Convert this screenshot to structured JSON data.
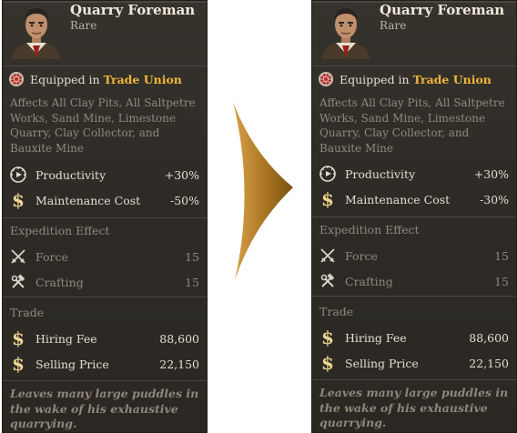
{
  "cards": {
    "before": {
      "name": "Quarry Foreman",
      "rarity": "Rare",
      "equipped_prefix": "Equipped in",
      "equipped_building": "Trade Union",
      "affects": "Affects All Clay Pits, All Saltpetre Works, Sand Mine, Limestone Quarry, Clay Collector, and Bauxite Mine",
      "productivity": {
        "label": "Productivity",
        "value": "+30%"
      },
      "maintenance": {
        "label": "Maintenance Cost",
        "value": "-50%"
      },
      "expedition_title": "Expedition Effect",
      "force": {
        "label": "Force",
        "value": "15"
      },
      "crafting": {
        "label": "Crafting",
        "value": "15"
      },
      "trade_title": "Trade",
      "hiring_fee": {
        "label": "Hiring Fee",
        "value": "88,600"
      },
      "selling_price": {
        "label": "Selling Price",
        "value": "22,150"
      },
      "flavor": "Leaves many large puddles in the wake of his exhaustive quarrying."
    },
    "after": {
      "name": "Quarry Foreman",
      "rarity": "Rare",
      "equipped_prefix": "Equipped in",
      "equipped_building": "Trade Union",
      "affects": "Affects All Clay Pits, All Saltpetre Works, Sand Mine, Limestone Quarry, Clay Collector, and Bauxite Mine",
      "productivity": {
        "label": "Productivity",
        "value": "+30%"
      },
      "maintenance": {
        "label": "Maintenance Cost",
        "value": "-30%"
      },
      "expedition_title": "Expedition Effect",
      "force": {
        "label": "Force",
        "value": "15"
      },
      "crafting": {
        "label": "Crafting",
        "value": "15"
      },
      "trade_title": "Trade",
      "hiring_fee": {
        "label": "Hiring Fee",
        "value": "88,600"
      },
      "selling_price": {
        "label": "Selling Price",
        "value": "22,150"
      },
      "flavor": "Leaves many large puddles in the wake of his exhaustive quarrying."
    }
  },
  "colors": {
    "accent_gold": "#f0b63c",
    "panel_bg": "#2e2b26",
    "muted_text": "#8f897d",
    "arrow": "#a87421"
  },
  "icons": {
    "portrait": "foreman-portrait",
    "equip": "trade-union-icon",
    "productivity": "productivity-gauge-icon",
    "money": "dollar-icon",
    "force": "crossed-swords-icon",
    "crafting": "hammer-wrench-icon",
    "arrow": "right-arrow-icon"
  }
}
